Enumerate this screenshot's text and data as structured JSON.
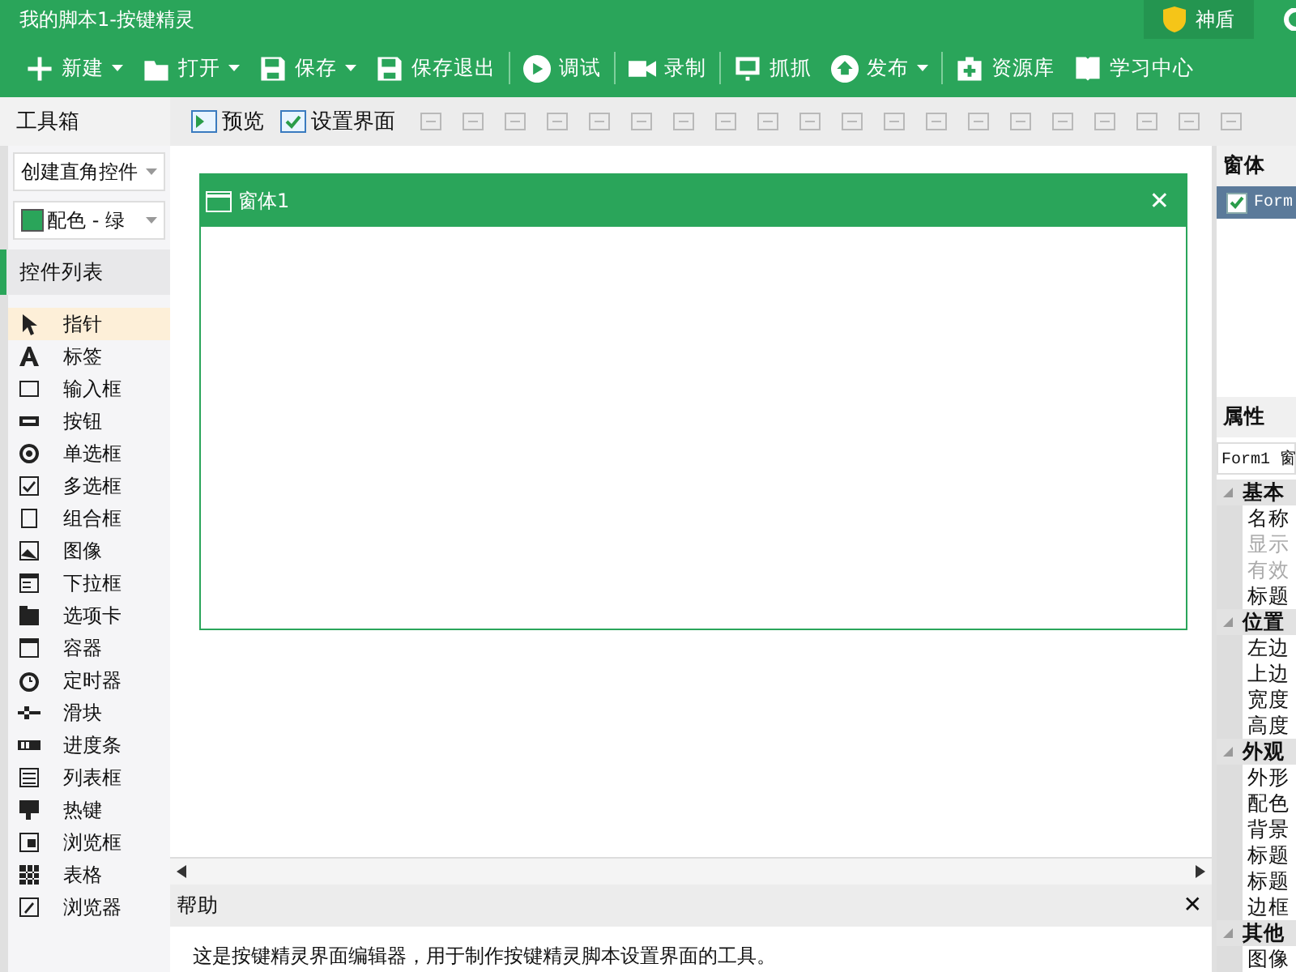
{
  "window": {
    "title": "我的脚本1-按键精灵",
    "shield_label": "神盾"
  },
  "main_toolbar": [
    {
      "label": "新建",
      "dropdown": true
    },
    {
      "label": "打开",
      "dropdown": true
    },
    {
      "label": "保存",
      "dropdown": true
    },
    {
      "label": "保存退出",
      "dropdown": false
    },
    {
      "label": "调试",
      "dropdown": false
    },
    {
      "label": "录制",
      "dropdown": false
    },
    {
      "label": "抓抓",
      "dropdown": false
    },
    {
      "label": "发布",
      "dropdown": true
    },
    {
      "label": "资源库",
      "dropdown": false
    },
    {
      "label": "学习中心",
      "dropdown": false
    }
  ],
  "editor_toolbar": [
    {
      "label": "预览",
      "disabled": false
    },
    {
      "label": "设置界面",
      "disabled": false
    }
  ],
  "toolbox": {
    "title": "工具箱",
    "create_mode": "创建直角控件",
    "color_scheme": "配色 - 绿",
    "list_title": "控件列表",
    "items": [
      {
        "label": "指针",
        "selected": true
      },
      {
        "label": "标签",
        "selected": false
      },
      {
        "label": "输入框",
        "selected": false
      },
      {
        "label": "按钮",
        "selected": false
      },
      {
        "label": "单选框",
        "selected": false
      },
      {
        "label": "多选框",
        "selected": false
      },
      {
        "label": "组合框",
        "selected": false
      },
      {
        "label": "图像",
        "selected": false
      },
      {
        "label": "下拉框",
        "selected": false
      },
      {
        "label": "选项卡",
        "selected": false
      },
      {
        "label": "容器",
        "selected": false
      },
      {
        "label": "定时器",
        "selected": false
      },
      {
        "label": "滑块",
        "selected": false
      },
      {
        "label": "进度条",
        "selected": false
      },
      {
        "label": "列表框",
        "selected": false
      },
      {
        "label": "热键",
        "selected": false
      },
      {
        "label": "浏览框",
        "selected": false
      },
      {
        "label": "表格",
        "selected": false
      },
      {
        "label": "浏览器",
        "selected": false
      }
    ]
  },
  "form": {
    "title": "窗体1",
    "close": "✕"
  },
  "help": {
    "title": "帮助",
    "close": "✕",
    "text": "这是按键精灵界面编辑器，用于制作按键精灵脚本设置界面的工具。"
  },
  "forms_panel": {
    "title": "窗体",
    "items": [
      {
        "label": "Form",
        "checked": true,
        "selected": true
      }
    ]
  },
  "properties": {
    "title": "属性",
    "object": "Form1 窗",
    "groups": [
      {
        "label": "基本",
        "expanded": true,
        "children": [
          {
            "label": "名称",
            "disabled": false
          },
          {
            "label": "显示",
            "disabled": true
          },
          {
            "label": "有效",
            "disabled": true
          },
          {
            "label": "标题",
            "disabled": false
          }
        ]
      },
      {
        "label": "位置",
        "expanded": true,
        "children": [
          {
            "label": "左边",
            "disabled": false
          },
          {
            "label": "上边",
            "disabled": false
          },
          {
            "label": "宽度",
            "disabled": false
          },
          {
            "label": "高度",
            "disabled": false
          }
        ]
      },
      {
        "label": "外观",
        "expanded": true,
        "children": [
          {
            "label": "外形",
            "disabled": false
          },
          {
            "label": "配色",
            "disabled": false
          },
          {
            "label": "背景",
            "disabled": false
          },
          {
            "label": "标题",
            "disabled": false
          },
          {
            "label": "标题",
            "disabled": false
          },
          {
            "label": "边框",
            "disabled": false
          }
        ]
      },
      {
        "label": "其他",
        "expanded": true,
        "children": [
          {
            "label": "图像",
            "disabled": false
          }
        ]
      }
    ]
  }
}
